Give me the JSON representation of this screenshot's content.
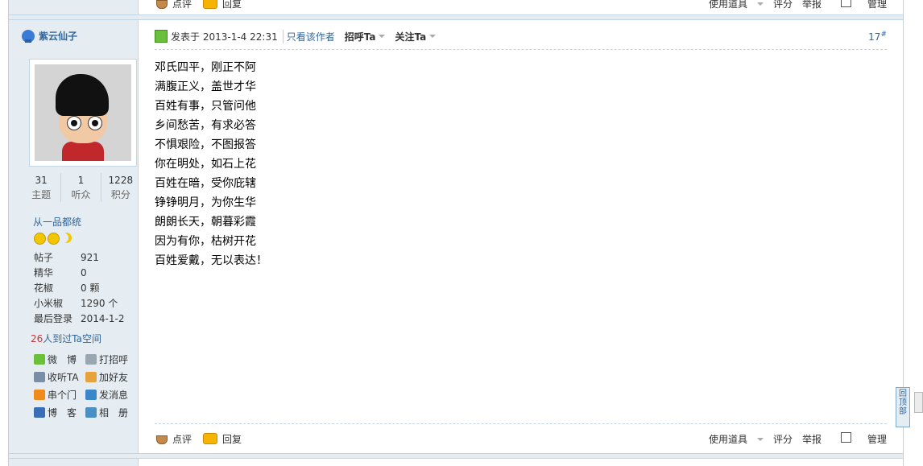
{
  "top_bar": {
    "comment_label": "点评",
    "reply_label": "回复",
    "tools_label": "使用道具",
    "rate_label": "评分",
    "report_label": "举报",
    "manage_label": "管理"
  },
  "author": {
    "name": "紫云仙子",
    "stats": [
      {
        "num": "31",
        "label": "主题"
      },
      {
        "num": "1",
        "label": "听众"
      },
      {
        "num": "1228",
        "label": "积分"
      }
    ],
    "rank": "从一品都统",
    "info": [
      {
        "k": "帖子",
        "v": "921"
      },
      {
        "k": "精华",
        "v": "0"
      },
      {
        "k": "花椒",
        "v": "0 颗"
      },
      {
        "k": "小米椒",
        "v": "1290 个"
      },
      {
        "k": "最后登录",
        "v": "2014-1-2"
      }
    ],
    "visits_count": "26",
    "visits_text": "人到过Ta空间",
    "links": [
      {
        "label": "微　博",
        "icon": "weibo-star-icon",
        "color": "#6bbf3b"
      },
      {
        "label": "打招呼",
        "icon": "wave-hand-icon",
        "color": "#9aa6b2"
      },
      {
        "label": "收听TA",
        "icon": "follow-users-icon",
        "color": "#7a8fa6"
      },
      {
        "label": "加好友",
        "icon": "handshake-icon",
        "color": "#e8a23c"
      },
      {
        "label": "串个门",
        "icon": "home-icon",
        "color": "#f08a1c"
      },
      {
        "label": "发消息",
        "icon": "envelope-icon",
        "color": "#3a86c8"
      },
      {
        "label": "博　客",
        "icon": "blog-icon",
        "color": "#3a6fb8"
      },
      {
        "label": "相　册",
        "icon": "photo-album-icon",
        "color": "#4a90c4"
      }
    ]
  },
  "post": {
    "posted_prefix": "发表于",
    "date": "2013-1-4 22:31",
    "only_author": "只看该作者",
    "greet": "招呼Ta",
    "follow": "关注Ta",
    "floor": "17",
    "floor_sup": "#",
    "lines": [
      "邓氏四平，刚正不阿",
      "满腹正义，盖世才华",
      "百姓有事，只管问他",
      "乡间愁苦，有求必答",
      "不惧艰险，不图报答",
      "你在明处，如石上花",
      "百姓在暗，受你庇辖",
      "铮铮明月，为你生华",
      "朗朗长天，朝暮彩霞",
      "因为有你，枯树开花",
      "百姓爱戴，无以表达！"
    ]
  },
  "bottom_bar": {
    "comment_label": "点评",
    "reply_label": "回复",
    "tools_label": "使用道具",
    "rate_label": "评分",
    "report_label": "举报",
    "manage_label": "管理"
  },
  "back_to_top": "回顶部"
}
